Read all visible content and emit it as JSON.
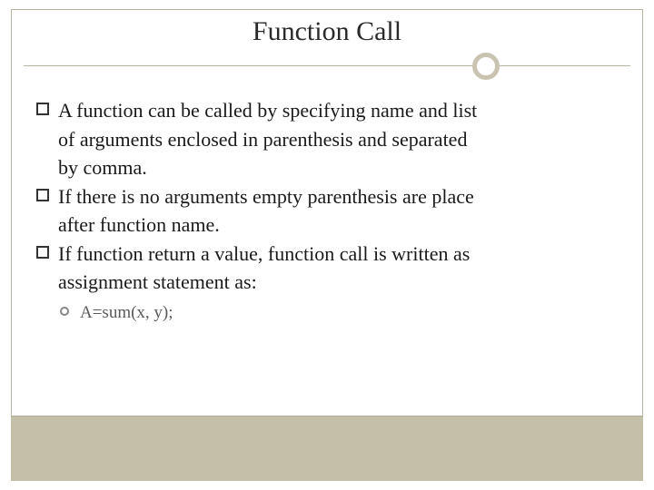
{
  "slide": {
    "title": "Function Call",
    "bullets": [
      {
        "lines": [
          "A function can be called by specifying name and list",
          "of arguments enclosed in parenthesis and separated",
          "by comma."
        ]
      },
      {
        "lines": [
          "If there is no arguments empty parenthesis are place",
          "after function name."
        ]
      },
      {
        "lines": [
          "If function return a value, function call is written as",
          "assignment statement as:"
        ],
        "sub": [
          "A=sum(x, y);"
        ]
      }
    ]
  }
}
